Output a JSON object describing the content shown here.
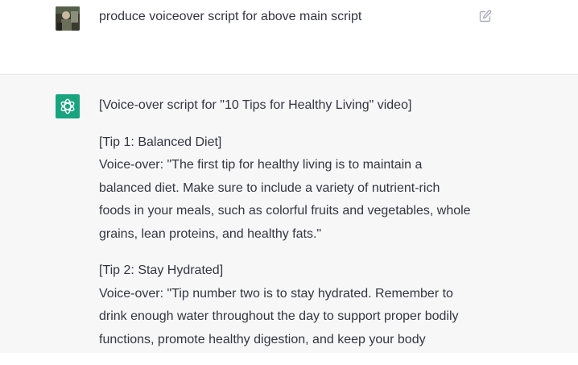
{
  "user_message": {
    "text": "produce voiceover script for above main script",
    "avatar_icon": "user-photo-avatar",
    "edit_icon": "edit-pencil-icon"
  },
  "assistant_message": {
    "avatar_icon": "openai-logo-icon",
    "accent_color": "#19a37f",
    "heading": "[Voice-over script for \"10 Tips for Healthy Living\" video]",
    "tips": [
      {
        "title": "[Tip 1: Balanced Diet]",
        "lines": [
          "Voice-over: \"The first tip for healthy living is to maintain a",
          "balanced diet. Make sure to include a variety of nutrient-rich",
          "foods in your meals, such as colorful fruits and vegetables, whole",
          "grains, lean proteins, and healthy fats.\""
        ]
      },
      {
        "title": "[Tip 2: Stay Hydrated]",
        "lines": [
          "Voice-over: \"Tip number two is to stay hydrated. Remember to",
          "drink enough water throughout the day to support proper bodily",
          "functions, promote healthy digestion, and keep your body"
        ]
      }
    ]
  }
}
